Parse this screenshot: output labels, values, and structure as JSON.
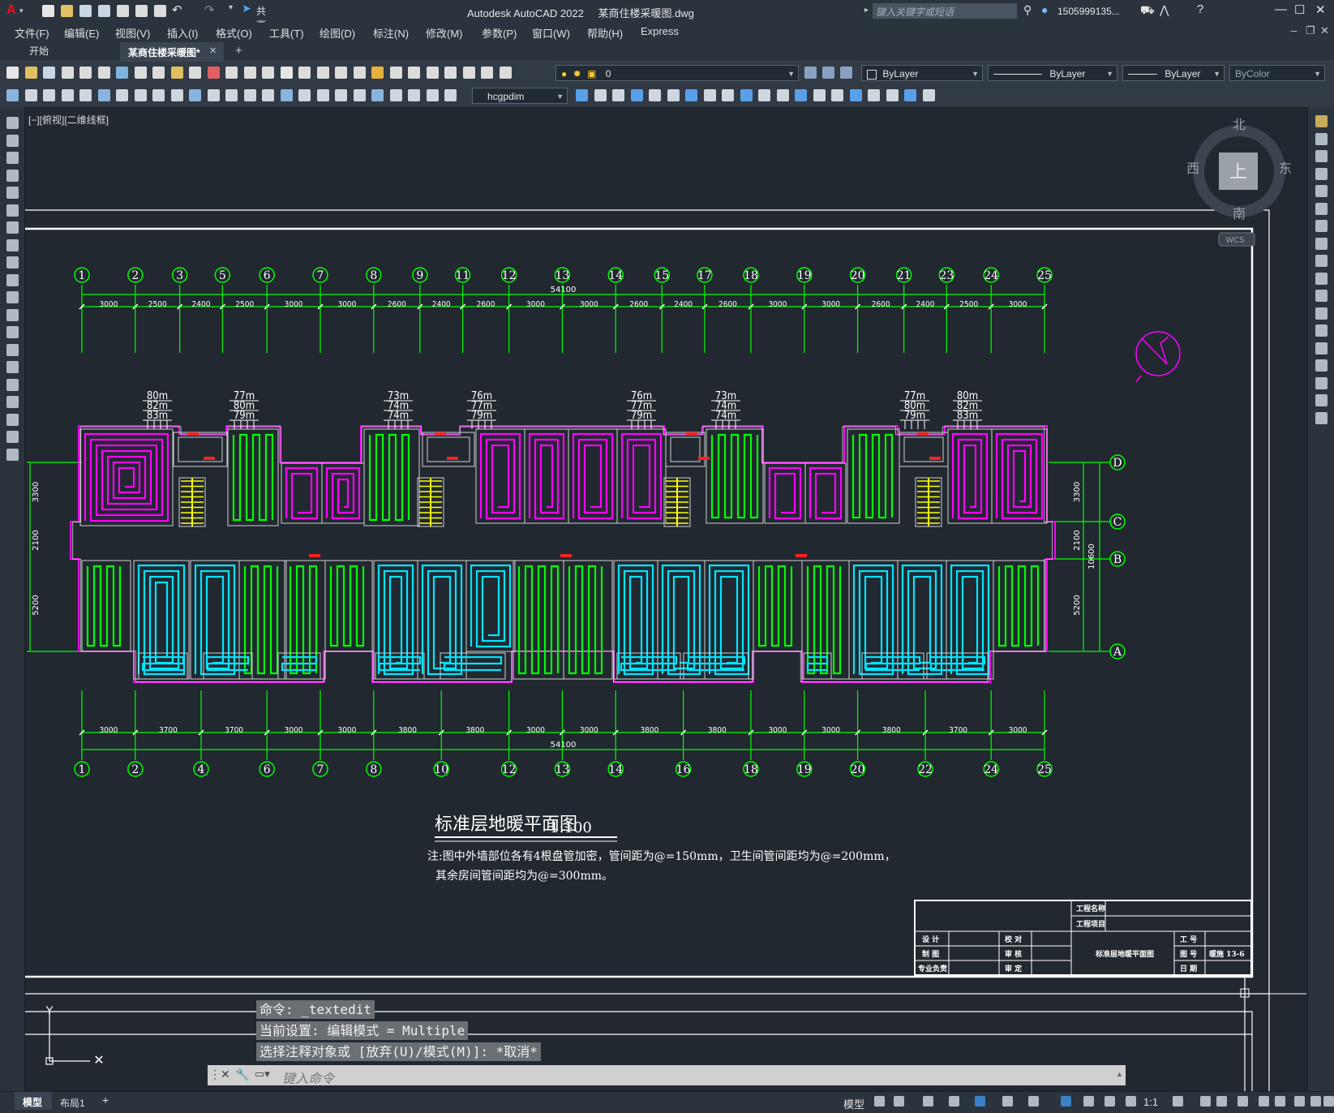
{
  "window": {
    "app_title": "Autodesk AutoCAD 2022",
    "file_title": "某商住楼采暖图.dwg",
    "share_label": "共享",
    "search_placeholder": "键入关键字或短语",
    "user_label": "1505999135...",
    "controls": [
      "—",
      "☐",
      "✕"
    ]
  },
  "menu": {
    "items": [
      "文件(F)",
      "编辑(E)",
      "视图(V)",
      "插入(I)",
      "格式(O)",
      "工具(T)",
      "绘图(D)",
      "标注(N)",
      "修改(M)",
      "参数(P)",
      "窗口(W)",
      "帮助(H)",
      "Express"
    ]
  },
  "tabs": {
    "start": "开始",
    "active": "某商住楼采暖图*",
    "close": "✕",
    "add": "+"
  },
  "toolbar": {
    "layer_value": "0",
    "dimstyle_value": "hcgpdim",
    "color_value": "ByLayer",
    "linetype_value": "ByLayer",
    "lineweight_value": "ByLayer",
    "plotstyle_value": "ByColor"
  },
  "viewport": {
    "label": "[−][俯视][二维线框]",
    "viewcube": {
      "north": "北",
      "south": "南",
      "east": "东",
      "west": "西",
      "top": "上",
      "wcs": "WCS"
    }
  },
  "drawing": {
    "top_axes": [
      "1",
      "2",
      "3",
      "5",
      "6",
      "7",
      "8",
      "9",
      "11",
      "12",
      "13",
      "14",
      "15",
      "17",
      "18",
      "19",
      "20",
      "21",
      "23",
      "24",
      "25"
    ],
    "top_dims": [
      "3000",
      "2500",
      "2400",
      "2500",
      "3000",
      "3000",
      "2600",
      "2400",
      "2600",
      "3000",
      "3000",
      "2600",
      "2400",
      "2600",
      "3000",
      "3000",
      "2600",
      "2400",
      "2500",
      "3000"
    ],
    "top_total": "54100",
    "bottom_axes": [
      "1",
      "2",
      "4",
      "6",
      "7",
      "8",
      "10",
      "12",
      "13",
      "14",
      "16",
      "18",
      "19",
      "20",
      "22",
      "24",
      "25"
    ],
    "bottom_dims": [
      "3000",
      "3700",
      "3700",
      "3000",
      "3000",
      "3800",
      "3800",
      "3000",
      "3000",
      "3800",
      "3800",
      "3000",
      "3000",
      "3800",
      "3700",
      "3000"
    ],
    "bottom_total": "54100",
    "right_axes": [
      "D",
      "C",
      "B",
      "A"
    ],
    "right_dims": [
      "3300",
      "2100",
      "5200"
    ],
    "right_total": "10600",
    "left_dims": [
      "3300",
      "2100",
      "5200"
    ],
    "loop_labels": [
      [
        "80m",
        "82m",
        "83m"
      ],
      [
        "77m",
        "80m",
        "79m"
      ],
      [
        "73m",
        "74m",
        "74m"
      ],
      [
        "76m",
        "77m",
        "79m"
      ],
      [
        "76m",
        "77m",
        "79m"
      ],
      [
        "73m",
        "74m",
        "74m"
      ],
      [
        "77m",
        "80m",
        "79m"
      ],
      [
        "80m",
        "82m",
        "83m"
      ]
    ],
    "plan_title": "标准层地暖平面图",
    "plan_scale": "1:100",
    "note_line1": "注:图中外墙部位各有4根盘管加密，管间距为@=150mm，卫生间管间距均为@=200mm，",
    "note_line2": "其余房间管间距均为@=300mm。",
    "title_block": {
      "project_name": "工程名称",
      "project_item": "工程项目",
      "design": "设 计",
      "draw": "制 图",
      "chief": "专业负责",
      "check": "校 对",
      "review": "审 核",
      "approve": "审 定",
      "drawing_name": "标准层地暖平面图",
      "job_no": "工 号",
      "drawing_no": "图 号",
      "drawing_no_value": "暖施 13-6",
      "date": "日 期"
    }
  },
  "command": {
    "line1": "命令: _textedit",
    "line2": "当前设置: 编辑模式 = Multiple",
    "line3": "选择注释对象或 [放弃(U)/模式(M)]: *取消*",
    "placeholder": "键入命令"
  },
  "status": {
    "model_tab": "模型",
    "layout_tab": "布局1",
    "add": "+",
    "model_label": "模型",
    "scale": "1:1"
  },
  "colors": {
    "magenta": "#ff00ff",
    "green": "#00ff00",
    "cyan": "#00e5ff",
    "yellow": "#ffff00",
    "white": "#ffffff",
    "red": "#ff2020"
  }
}
